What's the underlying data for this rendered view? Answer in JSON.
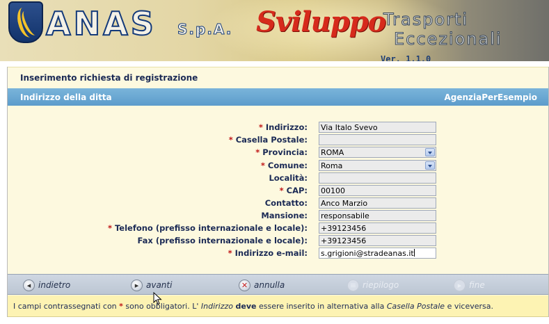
{
  "banner": {
    "brand": "ANAS",
    "brand_suffix": "S.p.A.",
    "product": "Sviluppo",
    "title_line1": "Trasporti",
    "title_line2": "Eccezionali",
    "version": "Ver. 1.1.0"
  },
  "page": {
    "title": "Inserimento richiesta di registrazione",
    "section_title": "Indirizzo della ditta",
    "company_name": "AgenziaPerEsempio"
  },
  "form": {
    "fields": [
      {
        "label": "Indirizzo:",
        "required": true,
        "value": "Via Italo Svevo",
        "type": "text"
      },
      {
        "label": "Casella Postale:",
        "required": true,
        "value": "",
        "type": "text"
      },
      {
        "label": "Provincia:",
        "required": true,
        "value": "ROMA",
        "type": "select"
      },
      {
        "label": "Comune:",
        "required": true,
        "value": "Roma",
        "type": "select"
      },
      {
        "label": "Località:",
        "required": false,
        "value": "",
        "type": "text"
      },
      {
        "label": "CAP:",
        "required": true,
        "value": "00100",
        "type": "text"
      },
      {
        "label": "Contatto:",
        "required": false,
        "value": "Anco Marzio",
        "type": "text"
      },
      {
        "label": "Mansione:",
        "required": false,
        "value": "responsabile",
        "type": "text"
      },
      {
        "label": "Telefono (prefisso internazionale e locale):",
        "required": true,
        "value": "+39123456",
        "type": "text"
      },
      {
        "label": "Fax (prefisso internazionale e locale):",
        "required": false,
        "value": "+39123456",
        "type": "text"
      },
      {
        "label": "Indirizzo e-mail:",
        "required": true,
        "value": "s.grigioni@stradeanas.it",
        "type": "text"
      }
    ],
    "required_marker": "*"
  },
  "nav": {
    "back": "indietro",
    "next": "avanti",
    "cancel": "annulla",
    "summary": "riepilogo",
    "finish": "fine"
  },
  "note": {
    "part1": "I campi contrassegnati con",
    "star": "*",
    "part2": "sono obbligatori. L'",
    "indirizzo": "Indirizzo",
    "deve": "deve",
    "part3": "essere inserito in alternativa alla",
    "casella": "Casella Postale",
    "part4": "e viceversa."
  },
  "colors": {
    "section_bar": "#6aa8d4",
    "panel_bg": "#fdf9df",
    "note_bg": "#fdf3b3",
    "required": "#c01818",
    "label": "#1b2a55"
  },
  "icons": {
    "back": "arrow-left-circle-icon",
    "next": "arrow-right-circle-icon",
    "cancel": "x-circle-icon",
    "summary": "document-icon",
    "finish": "arrow-right-circle-icon"
  }
}
